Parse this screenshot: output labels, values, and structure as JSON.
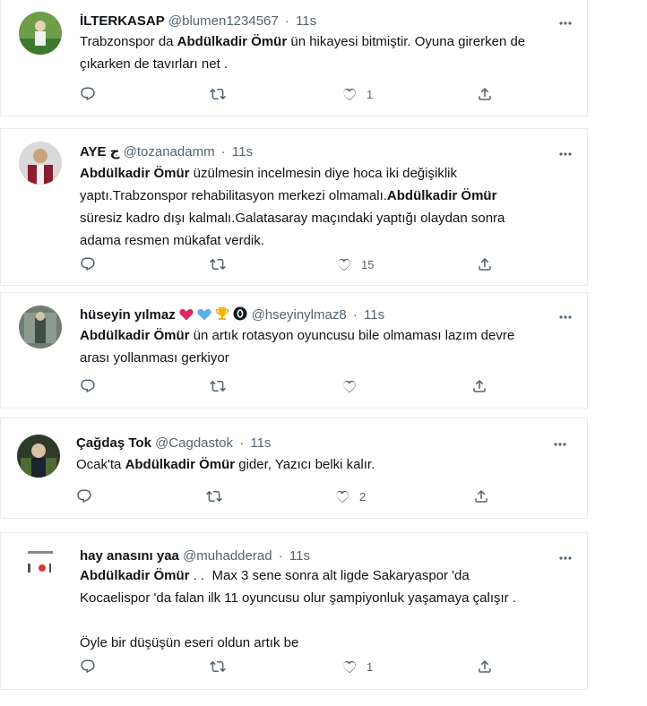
{
  "tweets": [
    {
      "name": "İLTERKASAP",
      "handle": "@blumen1234567",
      "time": "11s",
      "lines": [
        [
          {
            "t": "Trabzonspor da "
          },
          {
            "b": "Abdülkadir Ömür"
          },
          {
            "t": " ün hikayesi bitmiştir. Oyuna girerken de"
          }
        ],
        [
          {
            "t": "çıkarken de tavırları net ."
          }
        ]
      ],
      "like_count": "1",
      "retweet_count": "",
      "reply_count": ""
    },
    {
      "name": "AYE ج",
      "handle": "@tozanadamm",
      "time": "11s",
      "lines": [
        [
          {
            "b": "Abdülkadir Ömür"
          },
          {
            "t": " üzülmesin incelmesin diye hoca iki değişiklik"
          }
        ],
        [
          {
            "t": "yaptı.Trabzonspor rehabilitasyon merkezi olmamalı."
          },
          {
            "b": "Abdülkadir Ömür"
          }
        ],
        [
          {
            "t": "süresiz kadro dışı kalmalı.Galatasaray maçındaki yaptığı olaydan sonra"
          }
        ],
        [
          {
            "t": "adama resmen mükafat verdik."
          }
        ]
      ],
      "like_count": "15",
      "retweet_count": "",
      "reply_count": ""
    },
    {
      "name": "hüseyin yılmaz",
      "handle": "@hseyinylmaz8",
      "time": "11s",
      "lines": [
        [
          {
            "b": "Abdülkadir Ömür"
          },
          {
            "t": " ün artık rotasyon oyuncusu bile olmaması lazım devre"
          }
        ],
        [
          {
            "t": "arası yollanması gerkiyor"
          }
        ]
      ],
      "like_count": "",
      "retweet_count": "",
      "reply_count": ""
    },
    {
      "name": "Çağdaş Tok",
      "handle": "@Cagdastok",
      "time": "11s",
      "lines": [
        [
          {
            "t": "Ocak'ta "
          },
          {
            "b": "Abdülkadir Ömür"
          },
          {
            "t": " gider, Yazıcı belki kalır."
          }
        ]
      ],
      "like_count": "2",
      "retweet_count": "",
      "reply_count": ""
    },
    {
      "name": "hay anasını yaa",
      "handle": "@muhadderad",
      "time": "11s",
      "lines": [
        [
          {
            "b": "Abdülkadir Ömür"
          },
          {
            "t": " . .  Max 3 sene sonra alt ligde Sakaryaspor 'da"
          }
        ],
        [
          {
            "t": "Kocaelispor 'da falan ilk 11 oyuncusu olur şampiyonluk yaşamaya çalışır ."
          }
        ],
        [
          {
            "t": ""
          }
        ],
        [
          {
            "t": "Öyle bir düşüşün eseri oldun artık be"
          }
        ]
      ],
      "like_count": "1",
      "retweet_count": "",
      "reply_count": ""
    }
  ],
  "icons": {
    "reply": "reply-icon",
    "retweet": "retweet-icon",
    "like": "like-icon",
    "share": "share-icon",
    "more": "more-icon"
  },
  "colors": {
    "text": "#0f1419",
    "secondary": "#536471",
    "border": "#e6ecf0",
    "heart_emoji": "#e0245e",
    "blue_heart_emoji": "#5dadec",
    "trophy_emoji": "#f4b400"
  }
}
